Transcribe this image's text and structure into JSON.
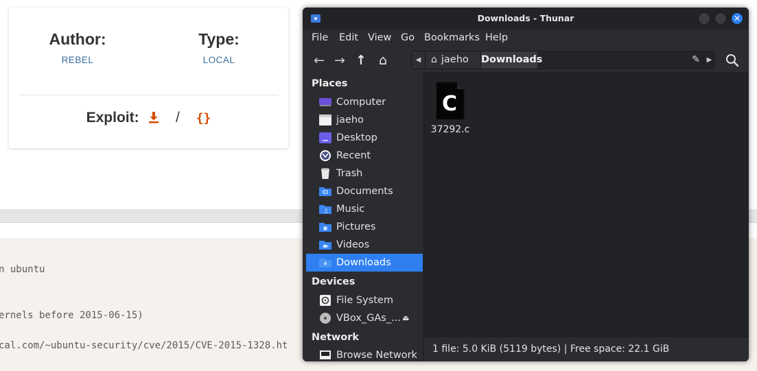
{
  "web_page": {
    "author_label": "Author:",
    "author_value": "REBEL",
    "type_label": "Type:",
    "type_value": "LOCAL",
    "exploit_label": "Exploit:",
    "exploit_download_icon": "download-icon",
    "exploit_separator": "/",
    "exploit_code_icon": "{}",
    "code_lines": [
      "n ubuntu",
      "ernels before 2015-06-15)",
      "cal.com/~ubuntu-security/cve/2015/CVE-2015-1328.ht"
    ],
    "accent_color": "#d64a00",
    "link_color": "#3a6e9c"
  },
  "window": {
    "title": "Downloads - Thunar",
    "close_glyph": "✕",
    "menu": [
      "File",
      "Edit",
      "View",
      "Go",
      "Bookmarks",
      "Help"
    ],
    "toolbar": {
      "back_icon": "←",
      "forward_icon": "→",
      "up_icon": "↑",
      "home_icon": "⌂"
    },
    "pathbar": {
      "left_arrow": "◀",
      "home_segment": "jaeho",
      "current_segment": "Downloads",
      "edit_icon": "✎",
      "right_arrow": "▶"
    },
    "sidebar": {
      "places_header": "Places",
      "places": [
        {
          "label": "Computer",
          "icon": "computer-icon"
        },
        {
          "label": "jaeho",
          "icon": "home-folder-icon"
        },
        {
          "label": "Desktop",
          "icon": "desktop-icon"
        },
        {
          "label": "Recent",
          "icon": "recent-icon"
        },
        {
          "label": "Trash",
          "icon": "trash-icon"
        },
        {
          "label": "Documents",
          "icon": "documents-folder-icon"
        },
        {
          "label": "Music",
          "icon": "music-folder-icon"
        },
        {
          "label": "Pictures",
          "icon": "pictures-folder-icon"
        },
        {
          "label": "Videos",
          "icon": "videos-folder-icon"
        },
        {
          "label": "Downloads",
          "icon": "downloads-folder-icon"
        }
      ],
      "devices_header": "Devices",
      "devices": [
        {
          "label": "File System",
          "icon": "drive-icon"
        },
        {
          "label": "VBox_GAs_...",
          "icon": "optical-disc-icon"
        }
      ],
      "eject_glyph": "⏏",
      "network_header": "Network",
      "network": [
        {
          "label": "Browse Network",
          "icon": "network-icon"
        }
      ]
    },
    "files": [
      {
        "name": "37292.c",
        "icon_letter": "C"
      }
    ],
    "status": "1 file: 5.0 KiB (5119 bytes)  |  Free space: 22.1 GiB",
    "selection_color": "#2f7ff0"
  }
}
